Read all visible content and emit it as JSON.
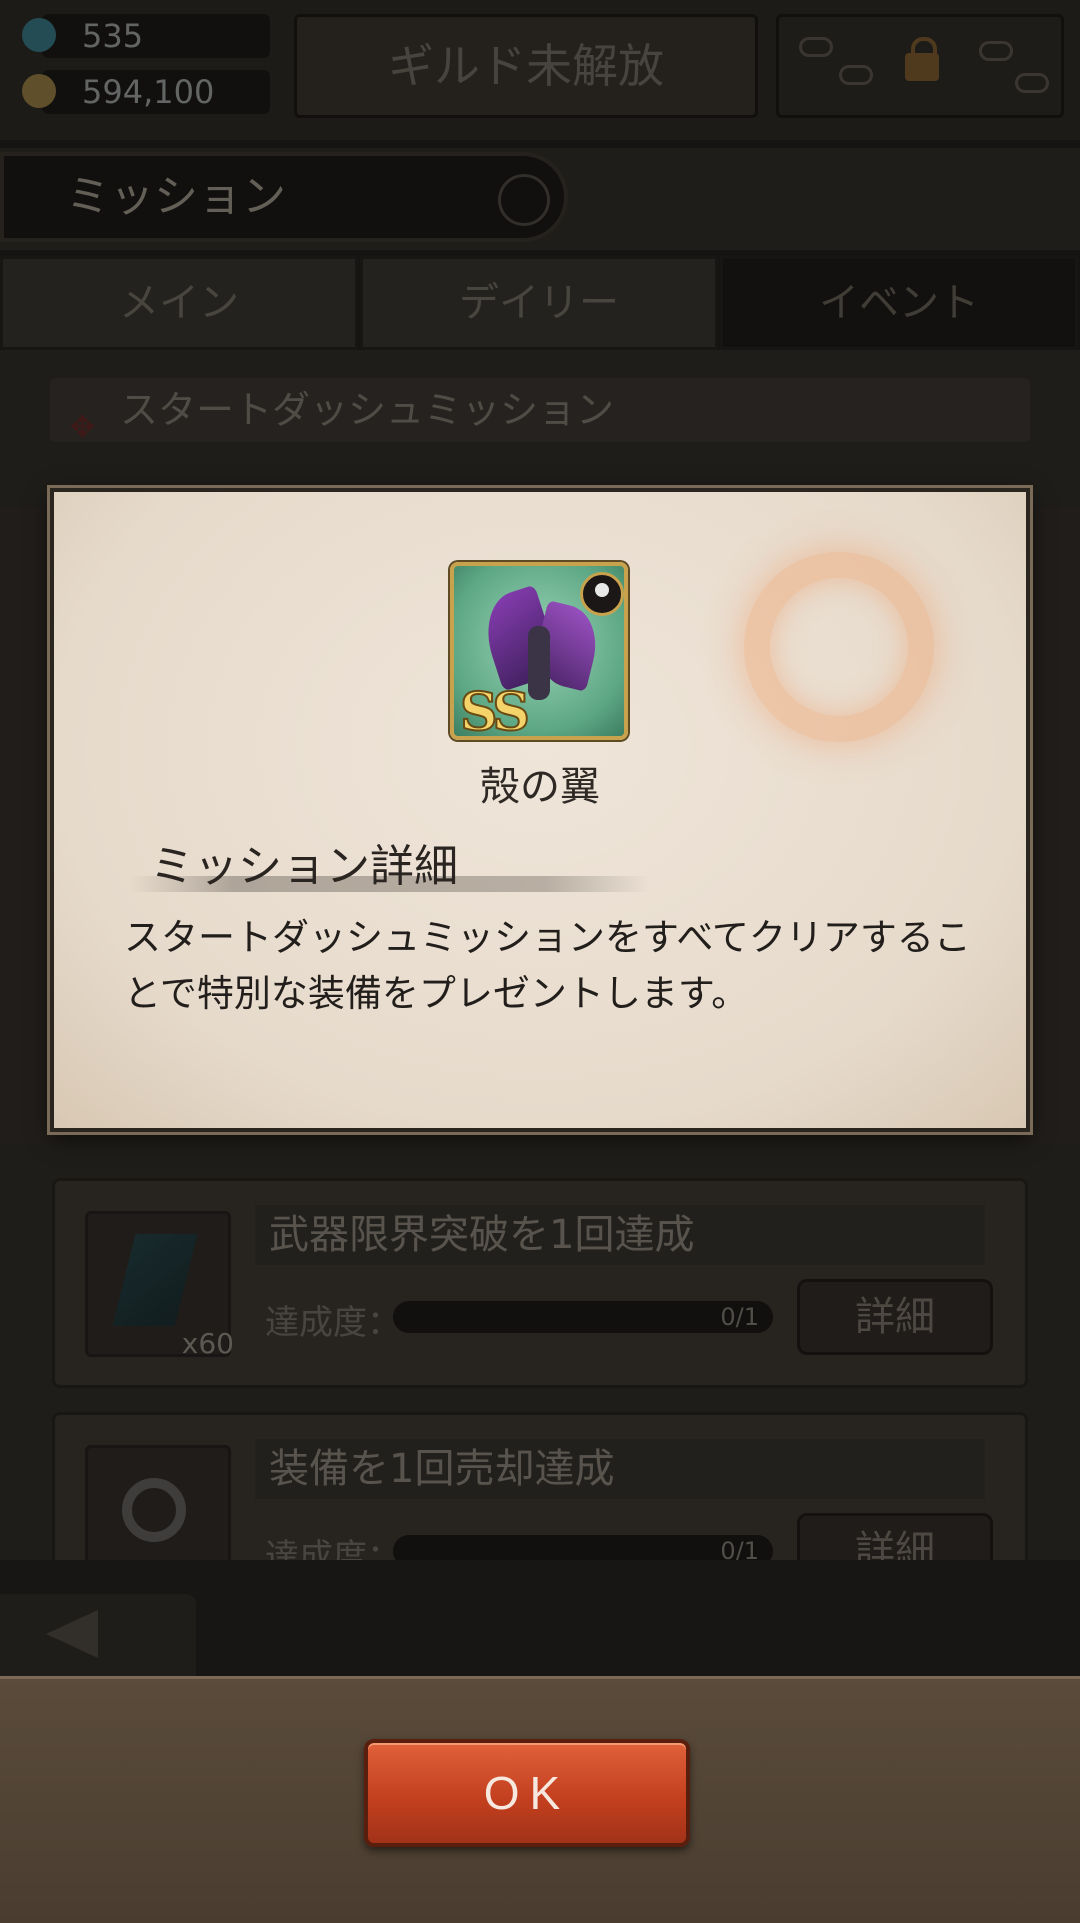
{
  "header": {
    "gems": "535",
    "gold": "594,100",
    "guild_label": "ギルド未解放"
  },
  "screen_title": "ミッション",
  "tabs": [
    {
      "label": "メイン",
      "active": false
    },
    {
      "label": "デイリー",
      "active": false
    },
    {
      "label": "イベント",
      "active": true
    }
  ],
  "section_header": "スタートダッシュミッション",
  "missions": [
    {
      "title": "武器限界突破を1回達成",
      "progress_label": "達成度：",
      "progress": "0/1",
      "reward_qty": "x60",
      "detail_label": "詳細",
      "icon": "crystal-icon"
    },
    {
      "title": "装備を1回売却達成",
      "progress_label": "達成度：",
      "progress": "0/1",
      "reward_qty": "",
      "detail_label": "詳細",
      "icon": "ring-icon"
    }
  ],
  "modal": {
    "item_name": "殻の翼",
    "item_rarity": "SS",
    "section_title": "ミッション詳細",
    "description": "スタートダッシュミッションをすべてクリアすることで特別な装備をプレゼントします。"
  },
  "ok_label": "OK",
  "colors": {
    "ok_button": "#c4401f",
    "modal_bg": "#e6dacb",
    "rarity_gold": "#f3d36a"
  }
}
